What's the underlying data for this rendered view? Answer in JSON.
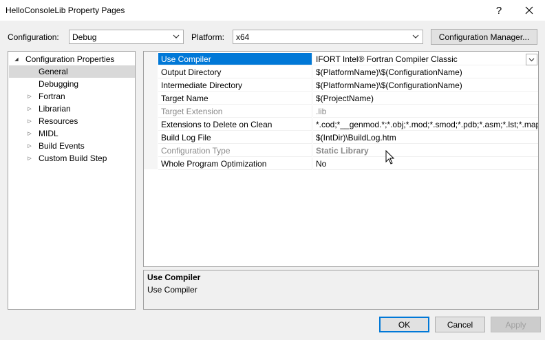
{
  "window": {
    "title": "HelloConsoleLib Property Pages",
    "help_glyph": "?",
    "close_glyph": "✕"
  },
  "toolbar": {
    "configuration_label": "Configuration:",
    "configuration_value": "Debug",
    "platform_label": "Platform:",
    "platform_value": "x64",
    "config_manager_label": "Configuration Manager..."
  },
  "tree": {
    "root": "Configuration Properties",
    "items": [
      {
        "label": "General",
        "expandable": false,
        "selected": true
      },
      {
        "label": "Debugging",
        "expandable": false
      },
      {
        "label": "Fortran",
        "expandable": true
      },
      {
        "label": "Librarian",
        "expandable": true
      },
      {
        "label": "Resources",
        "expandable": true
      },
      {
        "label": "MIDL",
        "expandable": true
      },
      {
        "label": "Build Events",
        "expandable": true
      },
      {
        "label": "Custom Build Step",
        "expandable": true
      }
    ]
  },
  "grid": {
    "rows": [
      {
        "name": "Use Compiler",
        "value": "IFORT Intel® Fortran Compiler Classic",
        "selected": true
      },
      {
        "name": "Output Directory",
        "value": "$(PlatformName)\\$(ConfigurationName)"
      },
      {
        "name": "Intermediate Directory",
        "value": "$(PlatformName)\\$(ConfigurationName)"
      },
      {
        "name": "Target Name",
        "value": "$(ProjectName)"
      },
      {
        "name": "Target Extension",
        "value": ".lib",
        "disabled": true
      },
      {
        "name": "Extensions to Delete on Clean",
        "value": "*.cod;*__genmod.*;*.obj;*.mod;*.smod;*.pdb;*.asm;*.lst;*.map"
      },
      {
        "name": "Build Log File",
        "value": "$(IntDir)\\BuildLog.htm"
      },
      {
        "name": "Configuration Type",
        "value": "Static Library",
        "disabled": true
      },
      {
        "name": "Whole Program Optimization",
        "value": "No"
      }
    ]
  },
  "description": {
    "title": "Use Compiler",
    "text": "Use Compiler"
  },
  "buttons": {
    "ok": "OK",
    "cancel": "Cancel",
    "apply": "Apply"
  }
}
